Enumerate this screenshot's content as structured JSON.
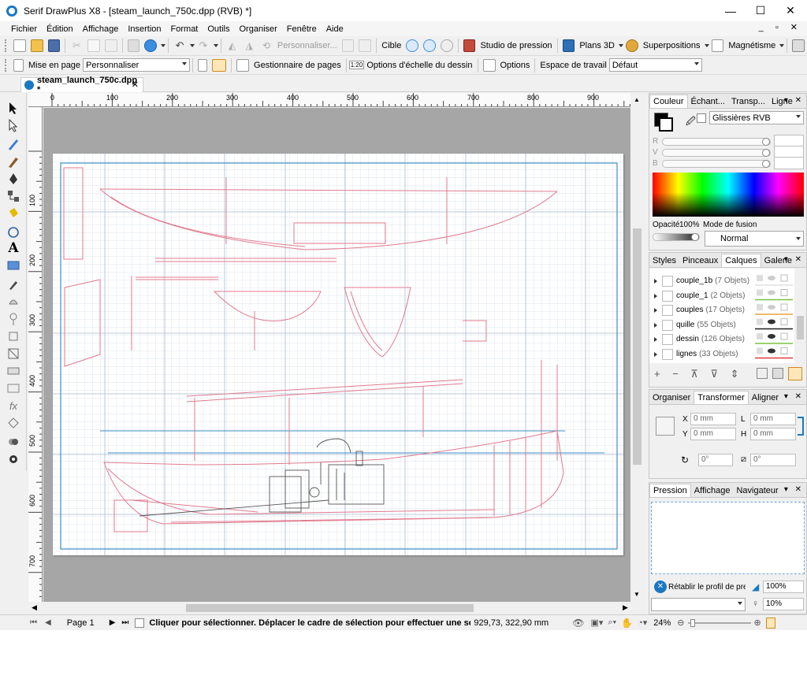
{
  "window": {
    "title": "Serif DrawPlus X8 - [steam_launch_750c.dpp (RVB) *]",
    "controls": {
      "minimize": "—",
      "maximize": "☐",
      "close": "✕"
    },
    "mdi_controls": "_ ▫ ✕"
  },
  "menu": [
    "Fichier",
    "Édition",
    "Affichage",
    "Insertion",
    "Format",
    "Outils",
    "Organiser",
    "Fenêtre",
    "Aide"
  ],
  "toolbar1": {
    "personnaliser": "Personnaliser...",
    "cible": "Cible",
    "studio_pression": "Studio de pression",
    "plans3d": "Plans 3D",
    "superpositions": "Superpositions",
    "magnetisme": "Magnétisme"
  },
  "toolbar2": {
    "mise_en_page": "Mise en page",
    "format_value": "Personnaliser",
    "gestionnaire": "Gestionnaire de pages",
    "echelle_icon_text": "1:20",
    "options_echelle": "Options d'échelle du dessin",
    "options": "Options",
    "espace_travail": "Espace de travail",
    "espace_value": "Défaut"
  },
  "document_tab": {
    "label": "steam_launch_750c.dpp *",
    "close": "✕"
  },
  "rulers": {
    "h_labels": [
      "0",
      "100",
      "200",
      "300",
      "400",
      "500",
      "600",
      "700",
      "800",
      "900"
    ],
    "v_labels": [
      "100",
      "200",
      "300",
      "400",
      "500",
      "600",
      "700"
    ]
  },
  "color_panel": {
    "tabs": [
      "Couleur",
      "Échant...",
      "Transp...",
      "Ligne"
    ],
    "mode": "Glissières RVB",
    "sliders": [
      "R",
      "V",
      "B"
    ],
    "opacity_label": "Opacité",
    "opacity_value": "100%",
    "blend_label": "Mode de fusion",
    "blend_value": "Normal"
  },
  "layers_panel": {
    "tabs": [
      "Styles",
      "Pinceaux",
      "Calques",
      "Galerie"
    ],
    "layers": [
      {
        "name": "couple_1b",
        "count": "(7 Objets)",
        "color": "#e0e0e0",
        "visible": false
      },
      {
        "name": "couple_1",
        "count": "(2 Objets)",
        "color": "#7ac143",
        "visible": false
      },
      {
        "name": "couples",
        "count": "(17 Objets)",
        "color": "#e8a33c",
        "visible": false
      },
      {
        "name": "quille",
        "count": "(55 Objets)",
        "color": "#222222",
        "visible": true
      },
      {
        "name": "dessin",
        "count": "(126 Objets)",
        "color": "#7ac143",
        "visible": true
      },
      {
        "name": "lignes",
        "count": "(33 Objets)",
        "color": "#e03a3a",
        "visible": true
      }
    ]
  },
  "transform_panel": {
    "tabs": [
      "Organiser",
      "Transformer",
      "Aligner"
    ],
    "x_label": "X",
    "x_value": "0 mm",
    "y_label": "Y",
    "y_value": "0 mm",
    "l_label": "L",
    "l_value": "0 mm",
    "h_label": "H",
    "h_value": "0 mm",
    "rot_value": "0°",
    "shear_value": "0°"
  },
  "pressure_panel": {
    "tabs": [
      "Pression",
      "Affichage",
      "Navigateur"
    ],
    "reset_label": "Rétablir le profil de press",
    "pct1": "100%",
    "pct2": "10%"
  },
  "status": {
    "page": "Page 1",
    "message": "Cliquer pour sélectionner. Déplacer le cadre de sélection pour effectuer une sélection mul...",
    "coords": "929,73, 322,90 mm",
    "zoom": "24%"
  },
  "colors": {
    "accent": "#1a78c2",
    "drawing_red": "#e07a8e",
    "guide_blue": "#3b8fc6",
    "grid": "#c9d3e0"
  }
}
